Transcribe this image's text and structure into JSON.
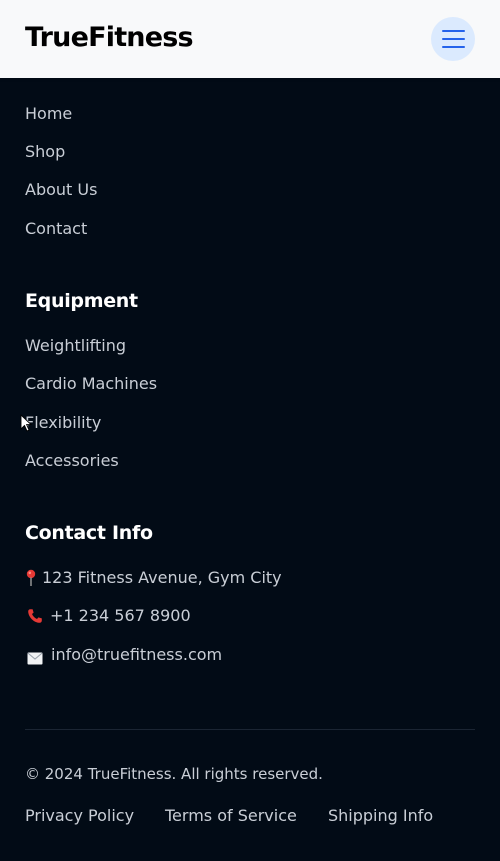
{
  "header": {
    "brand": "TrueFitness",
    "menu_icon": "hamburger-menu-icon",
    "accent_color": "#2563eb"
  },
  "quick_links": {
    "items": [
      {
        "label": "Home"
      },
      {
        "label": "Shop"
      },
      {
        "label": "About Us"
      },
      {
        "label": "Contact"
      }
    ]
  },
  "equipment": {
    "title": "Equipment",
    "items": [
      {
        "label": "Weightlifting"
      },
      {
        "label": "Cardio Machines"
      },
      {
        "label": "Flexibility"
      },
      {
        "label": "Accessories"
      }
    ]
  },
  "contact": {
    "title": "Contact Info",
    "address": {
      "icon": "location-pin-icon",
      "text": "123 Fitness Avenue, Gym City"
    },
    "phone": {
      "icon": "telephone-icon",
      "text": "+1 234 567 8900"
    },
    "email": {
      "icon": "envelope-icon",
      "text": "info@truefitness.com"
    }
  },
  "bottom": {
    "copyright": "© 2024 TrueFitness. All rights reserved.",
    "links": [
      {
        "label": "Privacy Policy"
      },
      {
        "label": "Terms of Service"
      },
      {
        "label": "Shipping Info"
      }
    ]
  },
  "colors": {
    "footer_bg": "#020b16",
    "text_muted": "#c9ced6",
    "heading": "#ffffff",
    "header_bg": "#f8f9fa"
  }
}
